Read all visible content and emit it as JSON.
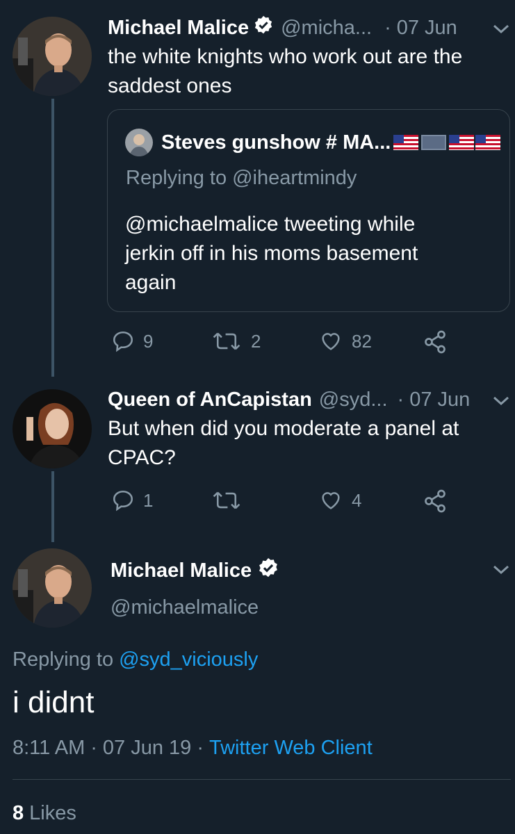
{
  "thread": [
    {
      "display_name": "Michael Malice",
      "handle": "@micha...",
      "separator": "·",
      "date": "07 Jun",
      "text": "the white knights who work out are the saddest ones",
      "quote": {
        "display_name": "Steves gunshow # MA...",
        "replying_prefix": "Replying to",
        "replying_to": "@iheartmindy",
        "text": "@michaelmalice tweeting while jerkin off in his moms basement again"
      },
      "replies": "9",
      "retweets": "2",
      "likes": "82"
    },
    {
      "display_name": "Queen of AnCapistan",
      "handle": "@syd...",
      "separator": "·",
      "date": "07 Jun",
      "text": "But when did you moderate a panel at CPAC?",
      "replies": "1",
      "retweets": "",
      "likes": "4"
    }
  ],
  "main_tweet": {
    "display_name": "Michael Malice",
    "handle": "@michaelmalice",
    "replying_prefix": "Replying to",
    "replying_to": "@syd_viciously",
    "text": "i didnt",
    "time": "8:11 AM",
    "separator1": "·",
    "date": "07 Jun 19",
    "separator2": "·",
    "client": "Twitter Web Client",
    "likes_count": "8",
    "likes_label": "Likes"
  },
  "colors": {
    "background": "#15202b",
    "muted": "#8899a6",
    "link": "#1da1f2",
    "thread_line": "#3d5466"
  }
}
